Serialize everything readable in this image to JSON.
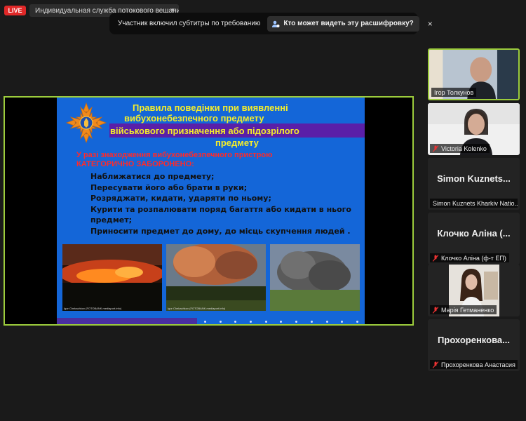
{
  "top_bar": {
    "live_label": "LIVE",
    "stream_mode": "Индивидуальная служба потокового вещания"
  },
  "caption_banner": {
    "text": "Участник включил субтитры по требованию",
    "button_label": "Кто может видеть эту расшифровку?",
    "close_symbol": "×"
  },
  "slide": {
    "title_lines": [
      "Правила поведінки при виявленні",
      "вибухонебезпечного предмету",
      "військового призначення або підозрілого",
      "предмету"
    ],
    "red_lines": [
      "У разі знаходження вибухонебезпечного пристрою",
      "КАТЕГОРИЧНО ЗАБОРОНЕНО:"
    ],
    "rules": [
      "Наближатися до предмету;",
      "Пересувати його або брати в руки;",
      "Розряджати, кидати, ударяти по ньому;",
      "Курити та розпалювати поряд багаття або кидати в нього предмет;",
      "Приносити предмет до дому, до місць скупчення людей ."
    ],
    "photo_captions": [
      "Igor Chekachkov (FOTOBANK.mediaport.info)",
      "Igor Chekachkov (FOTOBANK.mediaport.info)"
    ]
  },
  "participants": [
    {
      "name": "Ігор Толкунов",
      "video": true,
      "muted": false,
      "active": true
    },
    {
      "name": "Victoria Kolenko",
      "video": true,
      "muted": true,
      "active": false
    },
    {
      "name": "Simon Kuznets...",
      "label": "Simon Kuznets Kharkiv Natio...",
      "video": false,
      "muted": false
    },
    {
      "name": "Клочко Аліна (...",
      "label": "Клочко Аліна (ф-т ЕП)",
      "video": false,
      "muted": true
    },
    {
      "name": "Марія Гетманенко",
      "video": true,
      "muted": true,
      "active": false
    },
    {
      "name": "Прохоренкова...",
      "label": "Прохоренкова Анастасия",
      "video": false,
      "muted": true
    }
  ],
  "colors": {
    "live_red": "#e02828",
    "active_speaker_border": "#9ccc3c",
    "slide_blue": "#1466d8",
    "slide_title_yellow": "#f5ee2a",
    "slide_warning_red": "#ff2a2a"
  }
}
